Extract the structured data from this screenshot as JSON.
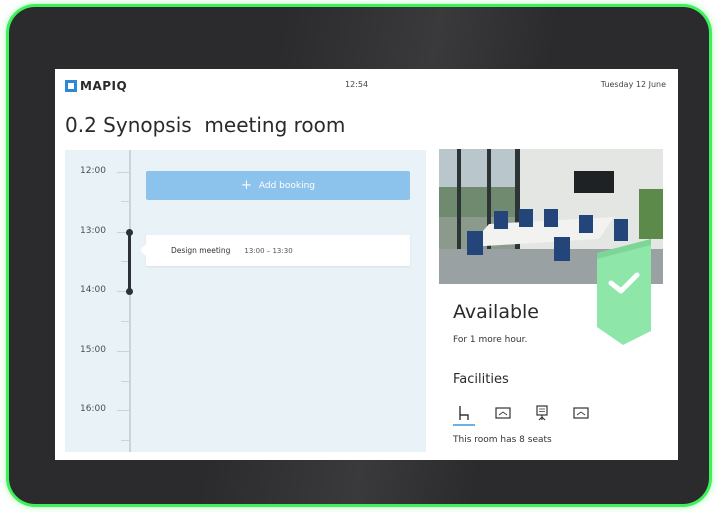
{
  "header": {
    "logo": "MAPIQ",
    "time": "12:54",
    "date": "Tuesday 12 June"
  },
  "room": {
    "title": "0.2 Synopsis  meeting room"
  },
  "timeline": {
    "hours": [
      "12:00",
      "13:00",
      "14:00",
      "15:00",
      "16:00"
    ],
    "add_booking_label": "Add booking",
    "bookings": [
      {
        "title": "Design meeting",
        "time": "13:00 – 13:30"
      }
    ]
  },
  "status": {
    "title": "Available",
    "subtitle": "For 1 more hour.",
    "accent_color": "#8ee6a8"
  },
  "facilities": {
    "title": "Facilities",
    "icons": [
      "chair-icon",
      "display-icon",
      "flipchart-icon",
      "screen-icon"
    ],
    "seats_text": "This room has 8 seats"
  },
  "colors": {
    "brand": "#2f88d6",
    "add_button": "#8cc3ec",
    "timeline_bg": "#e9f2f7",
    "device_glow": "#3ef05a"
  }
}
